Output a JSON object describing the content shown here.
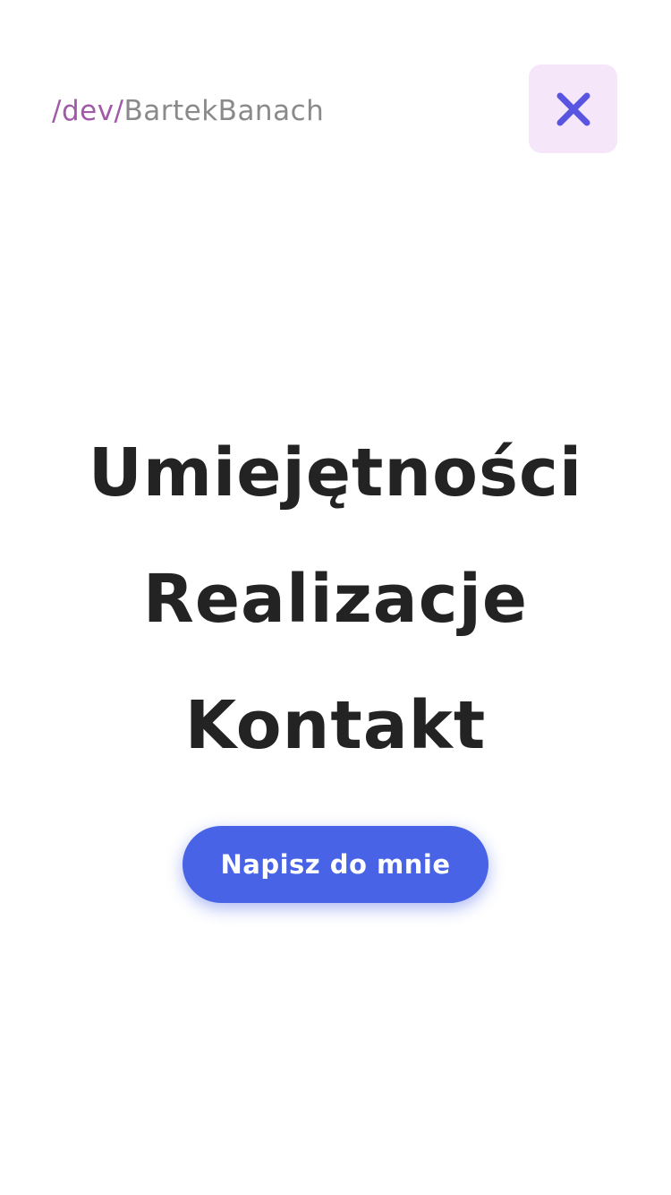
{
  "header": {
    "logo_prefix": "/dev/",
    "logo_name": "BartekBanach",
    "close_icon": "close-icon"
  },
  "nav": {
    "items": [
      {
        "label": "Umiejętności"
      },
      {
        "label": "Realizacje"
      },
      {
        "label": "Kontakt"
      }
    ]
  },
  "cta": {
    "label": "Napisz do mnie"
  },
  "colors": {
    "accent": "#4863e6",
    "logo_prefix": "#a05aa8",
    "logo_name": "#8a8a8a",
    "close_bg": "#f5e6fa",
    "close_icon": "#5a55e0",
    "nav_text": "#232323"
  }
}
